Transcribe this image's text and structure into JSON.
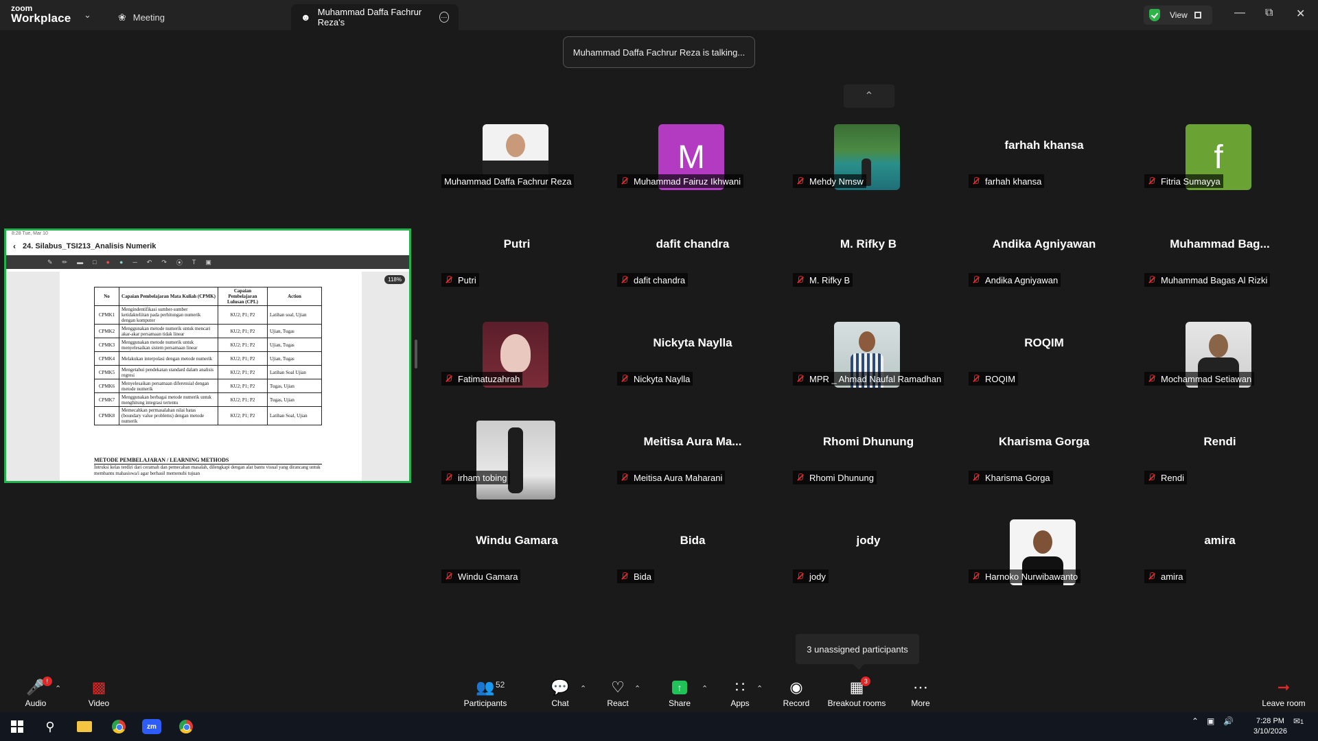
{
  "titlebar": {
    "logo_top": "zoom",
    "logo_bottom": "Workplace",
    "meeting_tab": "Meeting",
    "share_tab": "Muhammad Daffa Fachrur Reza's",
    "view_label": "View"
  },
  "toast": "Muhammad Daffa Fachrur Reza is talking...",
  "share": {
    "status": "8:28  Tue, Mar 10",
    "doc_title": "24. Silabus_TSI213_Analisis Numerik",
    "zoom_pill": "118%",
    "table": {
      "headers": [
        "No",
        "Capaian Pembelajaran Mata Kuliah (CPMK)",
        "Capaian Pembelajaran Lulusan (CPL)",
        "Action"
      ],
      "rows": [
        [
          "CPMK1",
          "Mengindentifikasi sumber-sumber ketidakteliitan pada perhitungan numerik dengan komputer",
          "KU2; P1; P2",
          "Latihan soal, Ujian"
        ],
        [
          "CPMK2",
          "Menggunakan metode numerik untuk mencari akar-akar persamaan tidak linear",
          "KU2; P1; P2",
          "Ujian, Tugas"
        ],
        [
          "CPMK3",
          "Menggunakan metode numerik untuk menyelesaikan sistem persamaan linear",
          "KU2; P1; P2",
          "Ujian, Tugas"
        ],
        [
          "CPMK4",
          "Melakukan interpolasi dengan metode numerik",
          "KU2; P1; P2",
          "Ujian, Tugas"
        ],
        [
          "CPMK5",
          "Mengetahui pendekatan standard dalam analisis regresi",
          "KU2; P1; P2",
          "Latihan Soal Ujian"
        ],
        [
          "CPMK6",
          "Menyelesaikan persamaan diferensial dengan metode numerik",
          "KU2; P1; P2",
          "Tugas, Ujian"
        ],
        [
          "CPMK7",
          "Menggunakan berbagai metode numerik untuk menghitung integrasi tertentu",
          "KU2; P1; P2",
          "Tugas, Ujian"
        ],
        [
          "CPMK8",
          "Memecahkan permasalahan nilai batas (boundary value problems) dengan metode numerik",
          "KU2; P1; P2",
          "Latihan Soal, Ujian"
        ]
      ]
    },
    "methods_heading": "METODE PEMBELAJARAN / LEARNING METHODS",
    "methods_text": "Intruksi kelas terdiri dari ceramah dan pemecahan masalah, dilengkapi dengan alat bantu visual yang dirancang untuk membantu mahasiswa/i agar berhasil memenuhi tujuan"
  },
  "participants": [
    {
      "name": "Muhammad Daffa Fachrur Reza",
      "display": "",
      "muted": false,
      "avatar": "photo",
      "photo": "suit"
    },
    {
      "name": "Muhammad Fairuz Ikhwani",
      "display": "",
      "muted": true,
      "avatar": "letter",
      "letter": "M",
      "color": "#b23bc2"
    },
    {
      "name": "Mehdy Nmsw",
      "display": "",
      "muted": true,
      "avatar": "photo",
      "photo": "lake"
    },
    {
      "name": "farhah khansa",
      "display": "farhah khansa",
      "muted": true,
      "avatar": "none"
    },
    {
      "name": "Fitria Sumayya",
      "display": "",
      "muted": true,
      "avatar": "letter",
      "letter": "f",
      "color": "#6aa334"
    },
    {
      "name": "Putri",
      "display": "Putri",
      "muted": true,
      "avatar": "none"
    },
    {
      "name": "dafit chandra",
      "display": "dafit chandra",
      "muted": true,
      "avatar": "none"
    },
    {
      "name": "M. Rifky B",
      "display": "M. Rifky B",
      "muted": true,
      "avatar": "none"
    },
    {
      "name": "Andika Agniyawan",
      "display": "Andika Agniyawan",
      "muted": true,
      "avatar": "none"
    },
    {
      "name": "Muhammad Bagas Al Rizki",
      "display": "Muhammad  Bag...",
      "muted": true,
      "avatar": "none"
    },
    {
      "name": "Fatimatuzahrah",
      "display": "",
      "muted": true,
      "avatar": "photo",
      "photo": "hijab"
    },
    {
      "name": "Nickyta Naylla",
      "display": "Nickyta Naylla",
      "muted": true,
      "avatar": "none"
    },
    {
      "name": "MPR _ Ahmad Naufal Ramadhan",
      "display": "",
      "muted": true,
      "avatar": "photo",
      "photo": "shirt"
    },
    {
      "name": "ROQIM",
      "display": "ROQIM",
      "muted": true,
      "avatar": "none"
    },
    {
      "name": "Mochammad Setiawan",
      "display": "",
      "muted": true,
      "avatar": "photo",
      "photo": "gray"
    },
    {
      "name": "irham tobing",
      "display": "",
      "muted": true,
      "avatar": "photo-wide",
      "photo": "stand"
    },
    {
      "name": "Meitisa Aura Maharani",
      "display": "Meitisa  Aura  Ma...",
      "muted": true,
      "avatar": "none"
    },
    {
      "name": "Rhomi Dhunung",
      "display": "Rhomi Dhunung",
      "muted": true,
      "avatar": "none"
    },
    {
      "name": "Kharisma Gorga",
      "display": "Kharisma Gorga",
      "muted": true,
      "avatar": "none"
    },
    {
      "name": "Rendi",
      "display": "Rendi",
      "muted": true,
      "avatar": "none"
    },
    {
      "name": "Windu Gamara",
      "display": "Windu Gamara",
      "muted": true,
      "avatar": "none"
    },
    {
      "name": "Bida",
      "display": "Bida",
      "muted": true,
      "avatar": "none"
    },
    {
      "name": "jody",
      "display": "jody",
      "muted": true,
      "avatar": "none"
    },
    {
      "name": "Harnoko Nurwibawanto",
      "display": "",
      "muted": true,
      "avatar": "photo",
      "photo": "white"
    },
    {
      "name": "amira",
      "display": "amira",
      "muted": true,
      "avatar": "none"
    }
  ],
  "unassigned": "3 unassigned participants",
  "toolbar": {
    "audio": "Audio",
    "video": "Video",
    "participants": "Participants",
    "participants_count": "52",
    "chat": "Chat",
    "react": "React",
    "share": "Share",
    "apps": "Apps",
    "record": "Record",
    "breakout": "Breakout rooms",
    "breakout_badge": "3",
    "more": "More",
    "leave": "Leave room"
  },
  "taskbar": {
    "time": "7:28 PM",
    "date": "3/10/2026",
    "notif_count": "1"
  },
  "colors": {
    "share_border": "#22b14c",
    "muted_mic": "#e02828",
    "share_button": "#22c25a"
  }
}
